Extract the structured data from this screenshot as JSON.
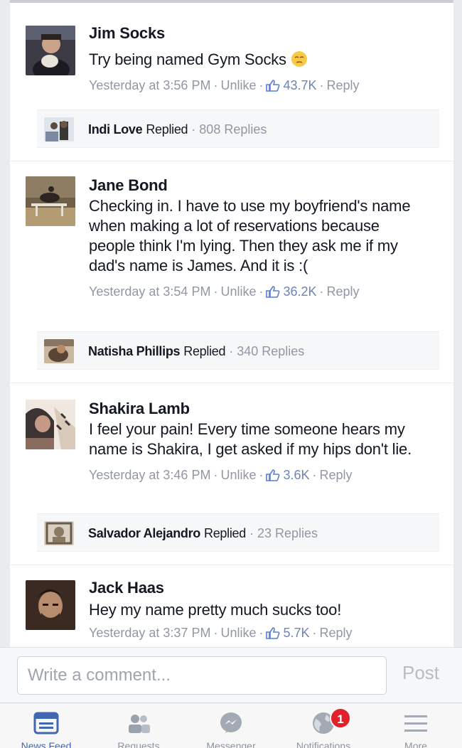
{
  "comments": [
    {
      "author": "Jim Socks",
      "text": "Try being named Gym Socks",
      "emoji": "pensive-face-emoji",
      "time": "Yesterday at 3:56 PM",
      "unlike": "Unlike",
      "likes": "43.7K",
      "reply": "Reply",
      "replied": {
        "name": "Indi Love",
        "word": "Replied",
        "count": "808 Replies"
      }
    },
    {
      "author": "Jane Bond",
      "text": "Checking in. I have to use my boyfriend's name when making a lot of reservations because people think I'm lying. Then they ask me if my dad's name is James. And it is :(",
      "time": "Yesterday at 3:54 PM",
      "unlike": "Unlike",
      "likes": "36.2K",
      "reply": "Reply",
      "replied": {
        "name": "Natisha Phillips",
        "word": "Replied",
        "count": "340 Replies"
      }
    },
    {
      "author": "Shakira Lamb",
      "text": "I feel your pain! Every time someone hears my name is Shakira, I get asked if my hips don't lie.",
      "time": "Yesterday at 3:46 PM",
      "unlike": "Unlike",
      "likes": "3.6K",
      "reply": "Reply",
      "replied": {
        "name": "Salvador Alejandro",
        "word": "Replied",
        "count": "23 Replies"
      }
    },
    {
      "author": "Jack Haas",
      "text": "Hey my name pretty much sucks too!",
      "time": "Yesterday at 3:37 PM",
      "unlike": "Unlike",
      "likes": "5.7K",
      "reply": "Reply"
    }
  ],
  "composer": {
    "placeholder": "Write a comment...",
    "post_label": "Post"
  },
  "tabbar": {
    "items": [
      {
        "label": "News Feed",
        "icon": "news-feed-icon",
        "active": true
      },
      {
        "label": "Requests",
        "icon": "friend-requests-icon"
      },
      {
        "label": "Messenger",
        "icon": "messenger-icon"
      },
      {
        "label": "Notifications",
        "icon": "globe-icon",
        "badge": "1"
      },
      {
        "label": "More",
        "icon": "hamburger-menu-icon"
      }
    ]
  },
  "colors": {
    "accent": "#4267b2",
    "meta": "#9197a3",
    "badge": "#e0202a",
    "text": "#141823"
  }
}
